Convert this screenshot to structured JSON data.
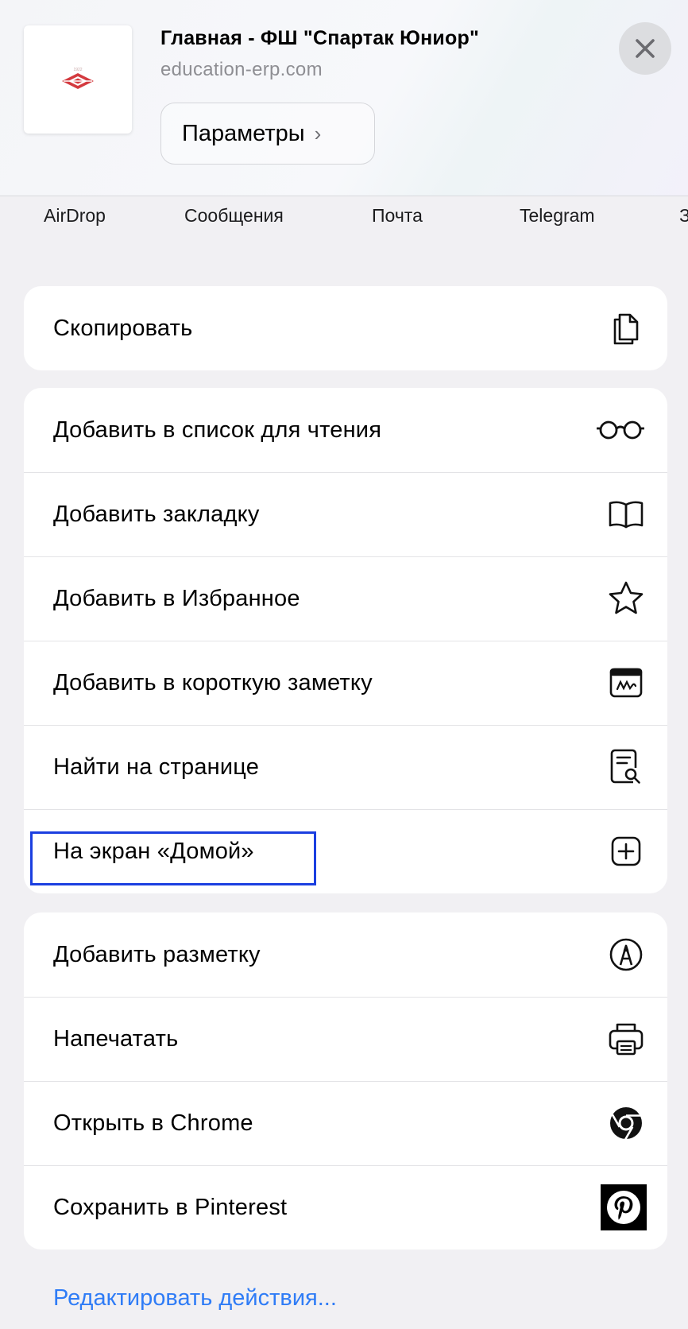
{
  "header": {
    "title": "Главная - ФШ \"Спартак Юниор\"",
    "url": "education-erp.com",
    "params_label": "Параметры",
    "params_chevron": "›",
    "close_icon": "close-icon",
    "thumbnail_icon": "spartak-logo"
  },
  "share_targets": [
    {
      "label": "AirDrop"
    },
    {
      "label": "Сообщения"
    },
    {
      "label": "Почта"
    },
    {
      "label": "Telegram"
    },
    {
      "label": "З"
    }
  ],
  "groups": [
    {
      "items": [
        {
          "label": "Скопировать",
          "icon": "copy-icon"
        }
      ]
    },
    {
      "items": [
        {
          "label": "Добавить в список для чтения",
          "icon": "glasses-icon"
        },
        {
          "label": "Добавить закладку",
          "icon": "book-icon"
        },
        {
          "label": "Добавить в Избранное",
          "icon": "star-icon"
        },
        {
          "label": "Добавить в короткую заметку",
          "icon": "quick-note-icon"
        },
        {
          "label": "Найти на странице",
          "icon": "find-in-page-icon"
        },
        {
          "label": "На экран «Домой»",
          "icon": "add-square-icon"
        }
      ]
    },
    {
      "items": [
        {
          "label": "Добавить разметку",
          "icon": "markup-icon"
        },
        {
          "label": "Напечатать",
          "icon": "printer-icon"
        },
        {
          "label": "Открыть в Chrome",
          "icon": "chrome-icon"
        },
        {
          "label": "Сохранить в Pinterest",
          "icon": "pinterest-icon"
        }
      ]
    }
  ],
  "edit_actions_label": "Редактировать действия...",
  "colors": {
    "accent_link": "#2f7cf6",
    "highlight_border": "#1b3fe0",
    "logo_red": "#d43a3f"
  }
}
